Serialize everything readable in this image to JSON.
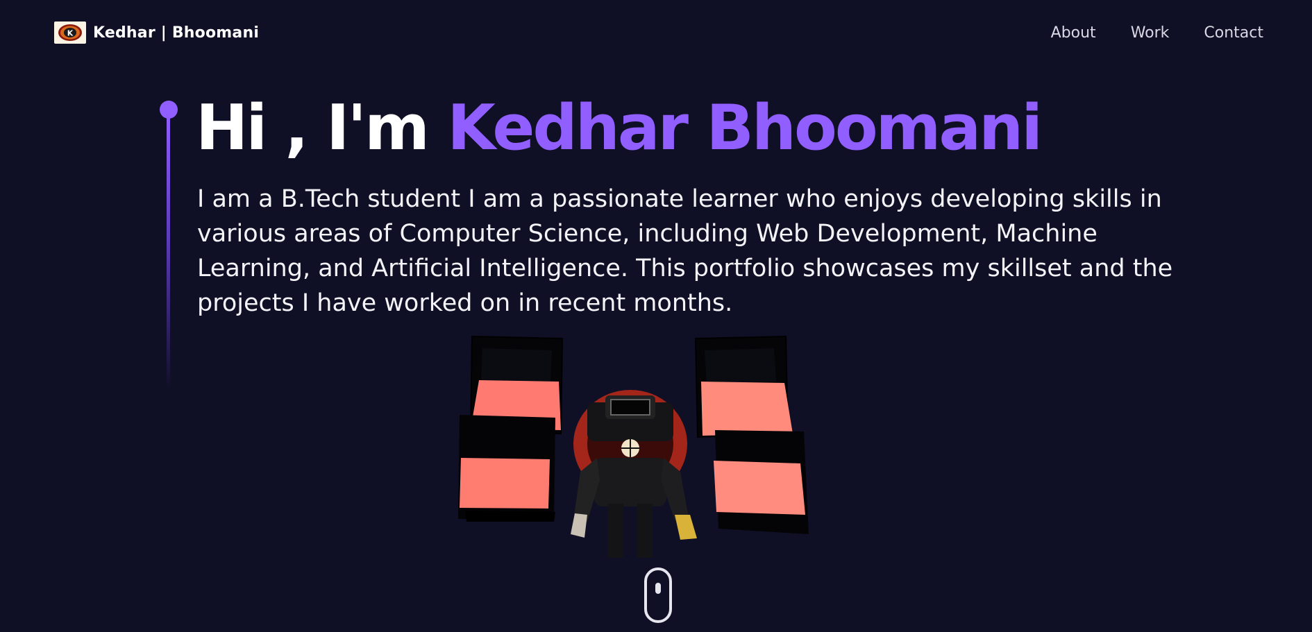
{
  "navbar": {
    "brand": "Kedhar | Bhoomani",
    "logo_letter": "K",
    "logo_icon": "brand-logo-icon",
    "links": [
      "About",
      "Work",
      "Contact"
    ]
  },
  "hero": {
    "greeting": "Hi , I'm ",
    "name": "Kedhar Bhoomani",
    "description": "I am a B.Tech student I am a passionate learner who enjoys developing skills in various areas of Computer Science, including Web Development, Machine Learning, and Artificial Intelligence. This portfolio showcases my skillset and the projects I have worked on in recent months."
  },
  "scroll_indicator": {
    "icon": "mouse-scroll-icon"
  },
  "colors": {
    "background": "#0f0f25",
    "accent": "#915eff",
    "panel": "#ff7f75"
  }
}
